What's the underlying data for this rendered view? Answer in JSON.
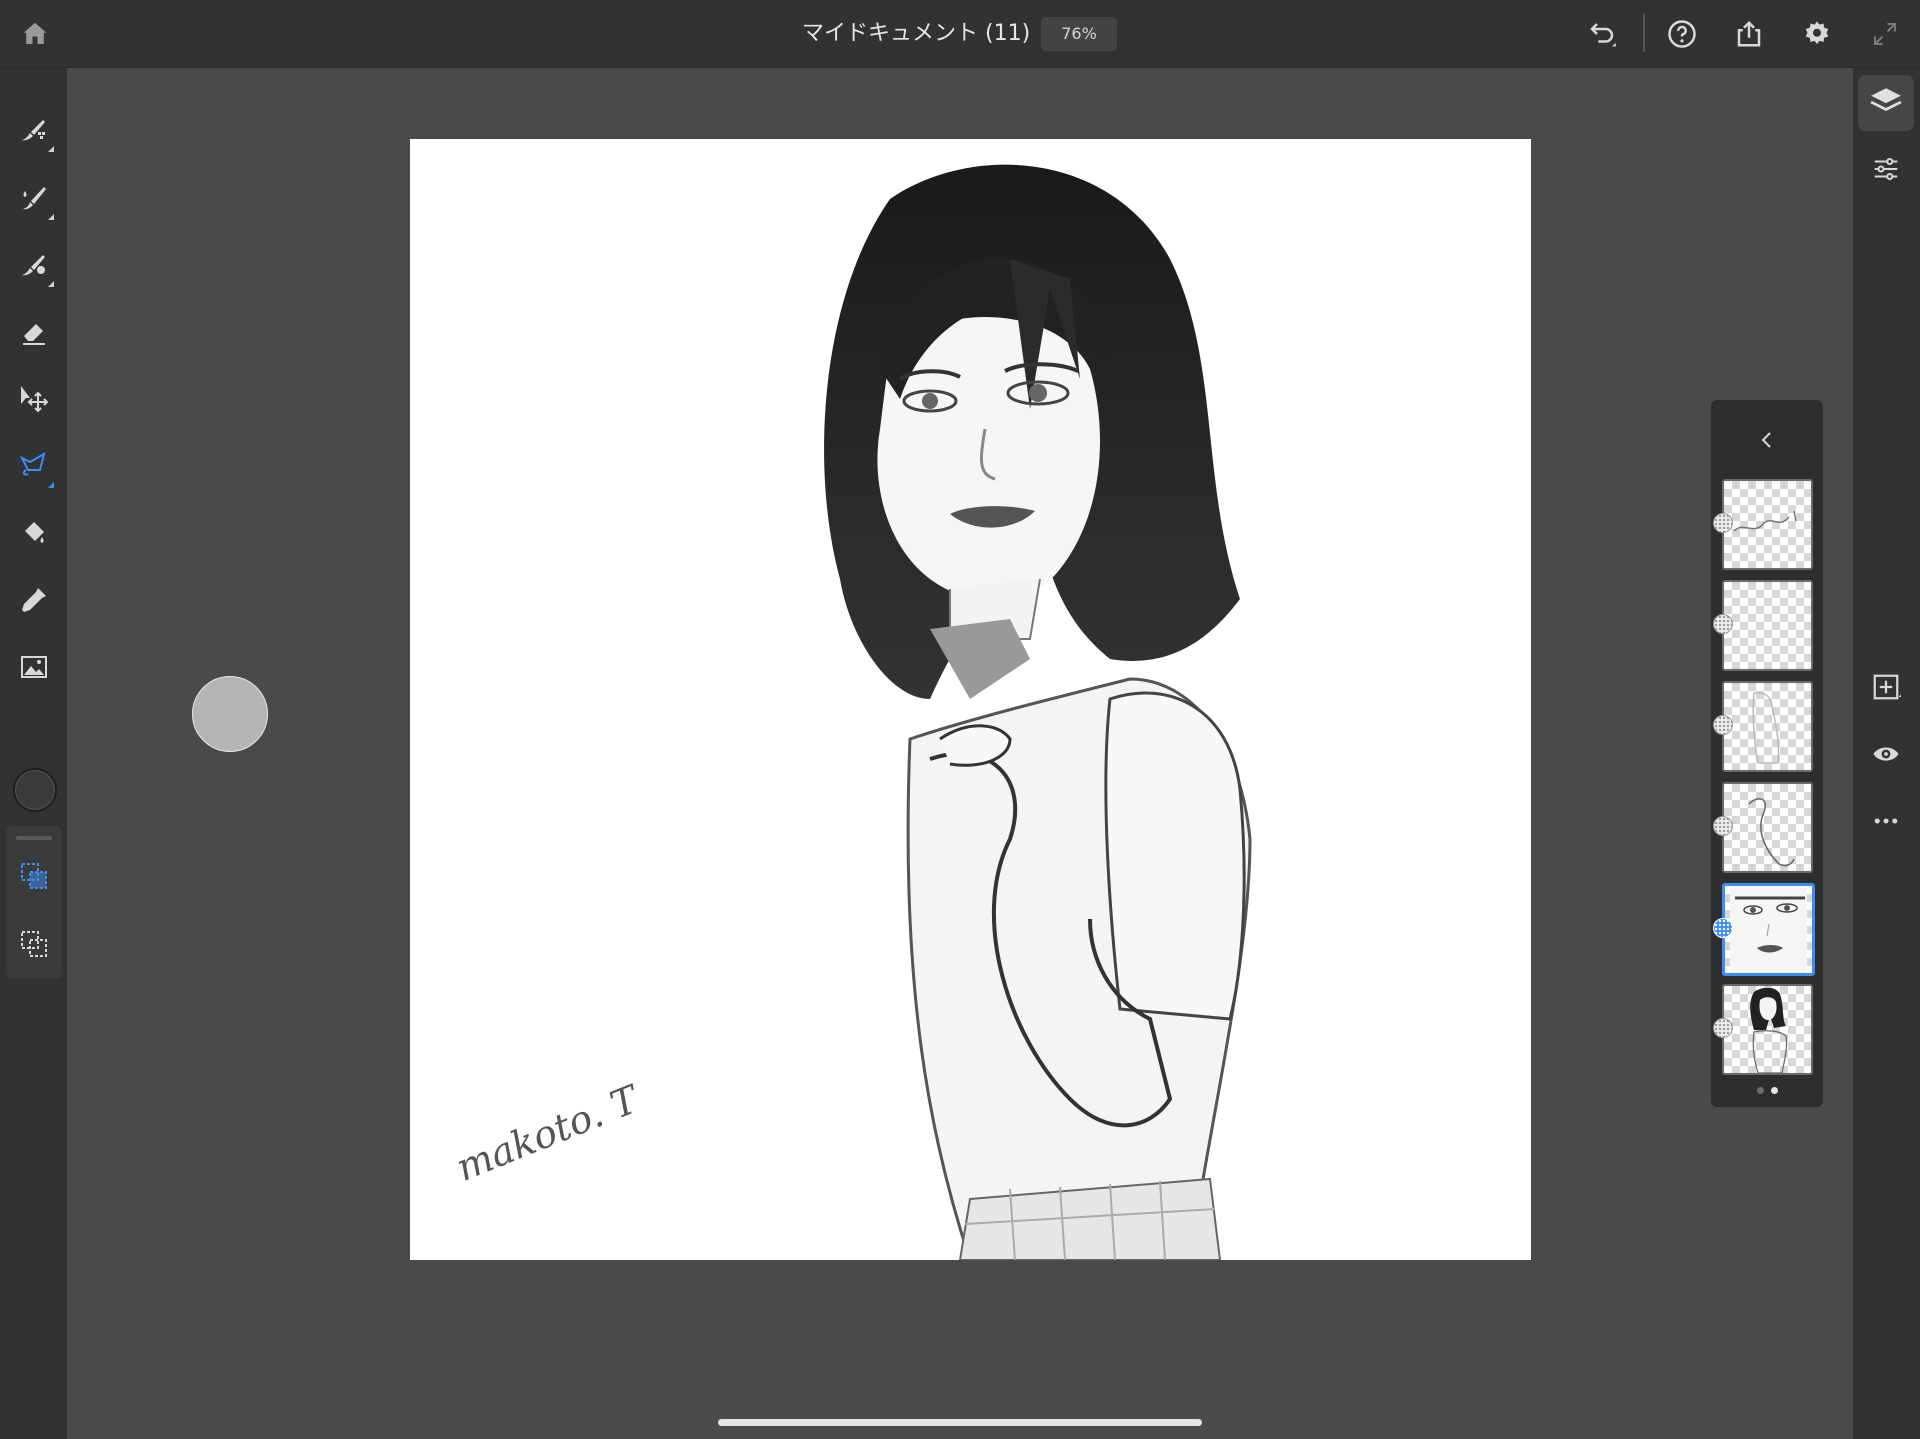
{
  "topbar": {
    "home_icon": "home-icon",
    "document_title": "マイドキュメント (11)",
    "zoom": "76%",
    "actions": [
      "undo-icon",
      "help-icon",
      "share-icon",
      "settings-icon",
      "fullscreen-icon"
    ]
  },
  "tools": [
    {
      "name": "pixel-brush",
      "icon": "pixel-brush-icon",
      "active": false
    },
    {
      "name": "live-brush",
      "icon": "live-brush-icon",
      "active": false
    },
    {
      "name": "vector-brush",
      "icon": "vector-brush-icon",
      "active": false
    },
    {
      "name": "eraser",
      "icon": "eraser-icon",
      "active": false
    },
    {
      "name": "transform",
      "icon": "transform-icon",
      "active": false
    },
    {
      "name": "selection",
      "icon": "lasso-selection-icon",
      "active": true
    },
    {
      "name": "fill",
      "icon": "fill-bucket-icon",
      "active": false
    },
    {
      "name": "eyedropper",
      "icon": "eyedropper-icon",
      "active": false
    },
    {
      "name": "place-image",
      "icon": "image-icon",
      "active": false
    }
  ],
  "selection_tools": [
    "add-selection-icon",
    "subtract-selection-icon"
  ],
  "colors": {
    "accent": "#3d8df5",
    "topbar": "#323232",
    "workspace": "#4a4a4a",
    "current_color": "#3a3a3a"
  },
  "right_rail": [
    "layers-icon",
    "properties-icon",
    "add-layer-icon",
    "visibility-icon",
    "more-icon"
  ],
  "canvas": {
    "signature": "makoto. T"
  },
  "layers_panel": {
    "collapse_icon": "chevron-left-icon",
    "layers": [
      {
        "content": "signature",
        "active": false
      },
      {
        "content": "empty",
        "active": false
      },
      {
        "content": "figure-sketch",
        "active": false
      },
      {
        "content": "arm-sketch",
        "active": false
      },
      {
        "content": "face",
        "active": true
      },
      {
        "content": "full-portrait",
        "active": false
      }
    ],
    "page_count": 2,
    "current_page": 2
  }
}
